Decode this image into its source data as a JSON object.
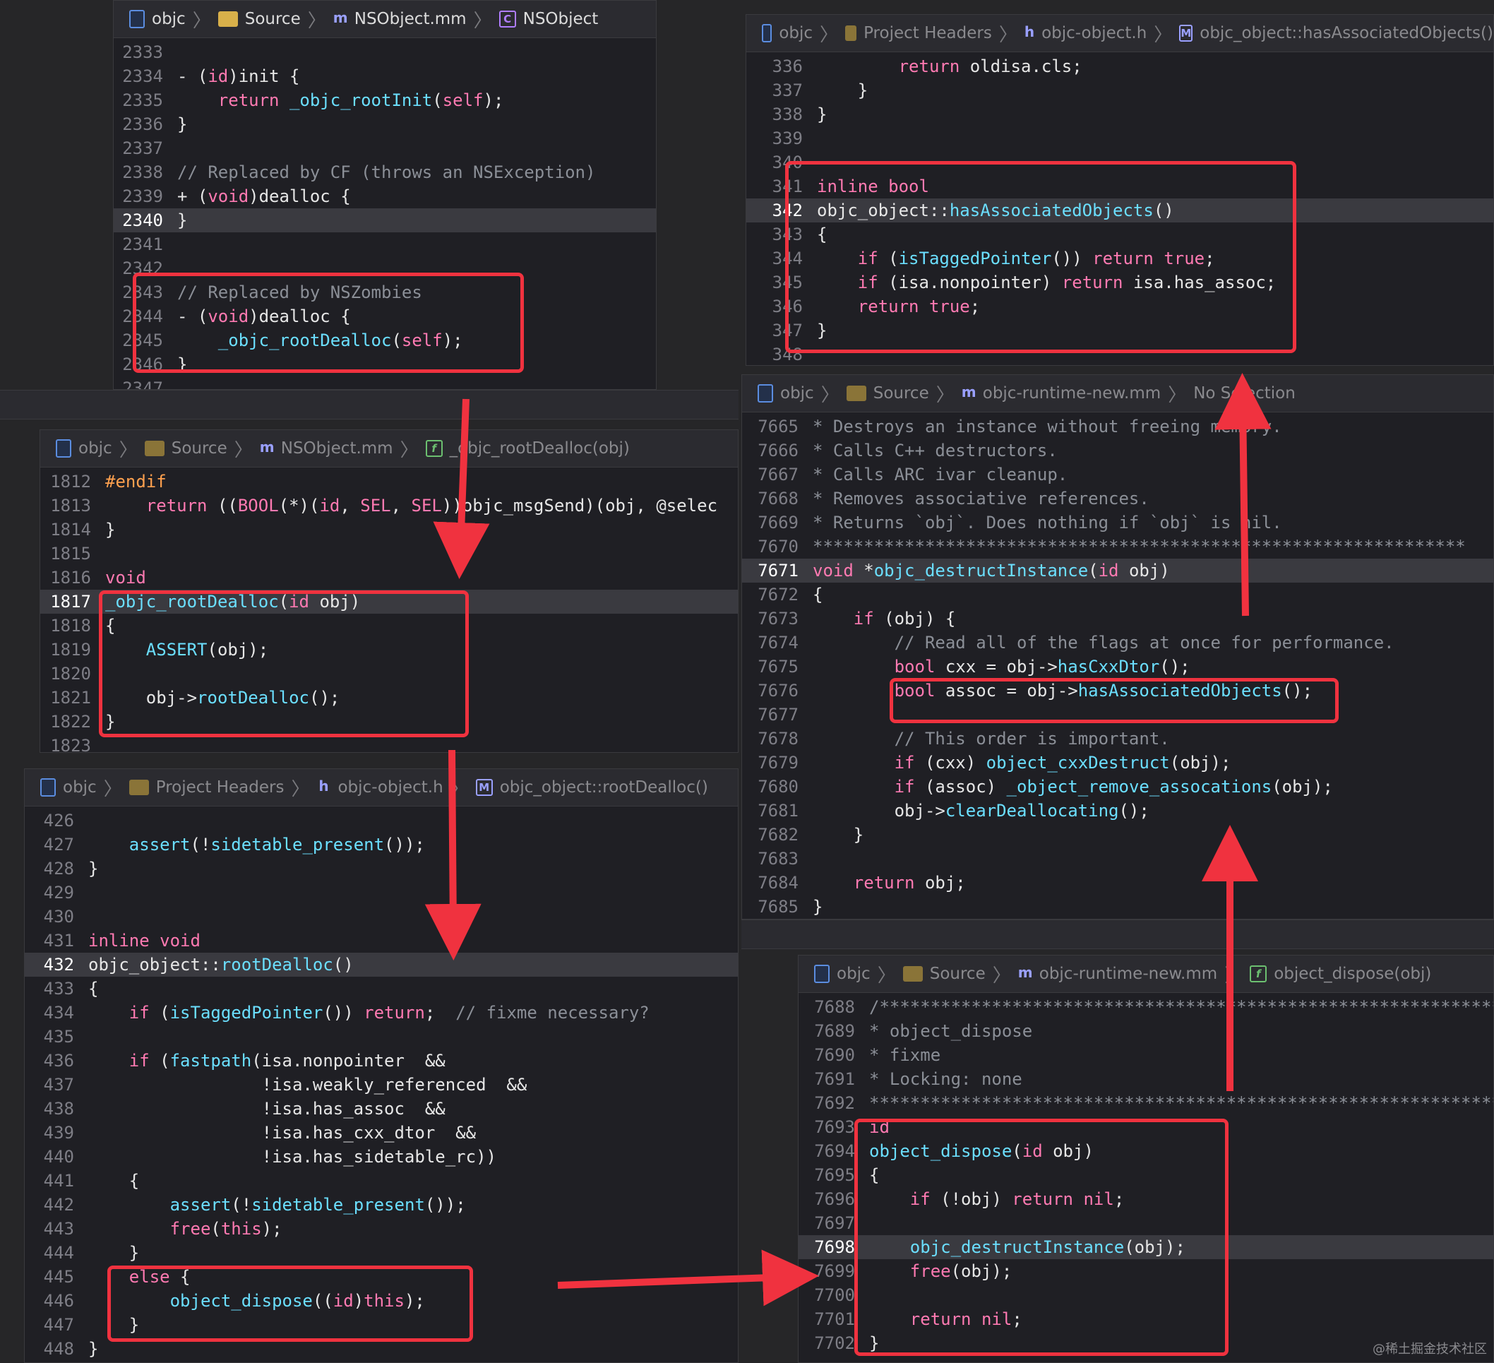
{
  "panes": {
    "nsobject_dealloc": {
      "breadcrumb": [
        "objc",
        "Source",
        "NSObject.mm",
        "NSObject"
      ],
      "lines": [
        {
          "n": "2333",
          "t": ""
        },
        {
          "n": "2334",
          "t": "- (id)init {"
        },
        {
          "n": "2335",
          "t": "    return _objc_rootInit(self);"
        },
        {
          "n": "2336",
          "t": "}"
        },
        {
          "n": "2337",
          "t": ""
        },
        {
          "n": "2338",
          "t": "// Replaced by CF (throws an NSException)"
        },
        {
          "n": "2339",
          "t": "+ (void)dealloc {"
        },
        {
          "n": "2340",
          "t": "}"
        },
        {
          "n": "2341",
          "t": ""
        },
        {
          "n": "2342",
          "t": ""
        },
        {
          "n": "2343",
          "t": "// Replaced by NSZombies"
        },
        {
          "n": "2344",
          "t": "- (void)dealloc {"
        },
        {
          "n": "2345",
          "t": "    _objc_rootDealloc(self);"
        },
        {
          "n": "2346",
          "t": "}"
        },
        {
          "n": "2347",
          "t": ""
        }
      ]
    },
    "root_dealloc_fn": {
      "breadcrumb": [
        "objc",
        "Source",
        "NSObject.mm",
        "_objc_rootDealloc(obj)"
      ],
      "lines": [
        {
          "n": "1812",
          "t": "#endif"
        },
        {
          "n": "1813",
          "t": "    return ((BOOL(*)(id, SEL, SEL))objc_msgSend)(obj, @selec"
        },
        {
          "n": "1814",
          "t": "}"
        },
        {
          "n": "1815",
          "t": ""
        },
        {
          "n": "1816",
          "t": "void"
        },
        {
          "n": "1817",
          "t": "_objc_rootDealloc(id obj)"
        },
        {
          "n": "1818",
          "t": "{"
        },
        {
          "n": "1819",
          "t": "    ASSERT(obj);"
        },
        {
          "n": "1820",
          "t": ""
        },
        {
          "n": "1821",
          "t": "    obj->rootDealloc();"
        },
        {
          "n": "1822",
          "t": "}"
        },
        {
          "n": "1823",
          "t": ""
        }
      ]
    },
    "object_root_dealloc": {
      "breadcrumb": [
        "objc",
        "Project Headers",
        "objc-object.h",
        "objc_object::rootDealloc()"
      ],
      "lines": [
        {
          "n": "426",
          "t": ""
        },
        {
          "n": "427",
          "t": "    assert(!sidetable_present());"
        },
        {
          "n": "428",
          "t": "}"
        },
        {
          "n": "429",
          "t": ""
        },
        {
          "n": "430",
          "t": ""
        },
        {
          "n": "431",
          "t": "inline void"
        },
        {
          "n": "432",
          "t": "objc_object::rootDealloc()"
        },
        {
          "n": "433",
          "t": "{"
        },
        {
          "n": "434",
          "t": "    if (isTaggedPointer()) return;  // fixme necessary?"
        },
        {
          "n": "435",
          "t": ""
        },
        {
          "n": "436",
          "t": "    if (fastpath(isa.nonpointer  &&"
        },
        {
          "n": "437",
          "t": "                 !isa.weakly_referenced  &&"
        },
        {
          "n": "438",
          "t": "                 !isa.has_assoc  &&"
        },
        {
          "n": "439",
          "t": "                 !isa.has_cxx_dtor  &&"
        },
        {
          "n": "440",
          "t": "                 !isa.has_sidetable_rc))"
        },
        {
          "n": "441",
          "t": "    {"
        },
        {
          "n": "442",
          "t": "        assert(!sidetable_present());"
        },
        {
          "n": "443",
          "t": "        free(this);"
        },
        {
          "n": "444",
          "t": "    }"
        },
        {
          "n": "445",
          "t": "    else {"
        },
        {
          "n": "446",
          "t": "        object_dispose((id)this);"
        },
        {
          "n": "447",
          "t": "    }"
        },
        {
          "n": "448",
          "t": "}"
        }
      ]
    },
    "has_associated": {
      "breadcrumb": [
        "objc",
        "Project Headers",
        "objc-object.h",
        "objc_object::hasAssociatedObjects()"
      ],
      "lines": [
        {
          "n": "336",
          "t": "        return oldisa.cls;"
        },
        {
          "n": "337",
          "t": "    }"
        },
        {
          "n": "338",
          "t": "}"
        },
        {
          "n": "339",
          "t": ""
        },
        {
          "n": "340",
          "t": ""
        },
        {
          "n": "341",
          "t": "inline bool"
        },
        {
          "n": "342",
          "t": "objc_object::hasAssociatedObjects()"
        },
        {
          "n": "343",
          "t": "{"
        },
        {
          "n": "344",
          "t": "    if (isTaggedPointer()) return true;"
        },
        {
          "n": "345",
          "t": "    if (isa.nonpointer) return isa.has_assoc;"
        },
        {
          "n": "346",
          "t": "    return true;"
        },
        {
          "n": "347",
          "t": "}"
        },
        {
          "n": "348",
          "t": ""
        }
      ]
    },
    "destruct_instance": {
      "breadcrumb": [
        "objc",
        "Source",
        "objc-runtime-new.mm",
        "No Selection"
      ],
      "lines": [
        {
          "n": "7665",
          "t": "* Destroys an instance without freeing memory."
        },
        {
          "n": "7666",
          "t": "* Calls C++ destructors."
        },
        {
          "n": "7667",
          "t": "* Calls ARC ivar cleanup."
        },
        {
          "n": "7668",
          "t": "* Removes associative references."
        },
        {
          "n": "7669",
          "t": "* Returns `obj`. Does nothing if `obj` is nil."
        },
        {
          "n": "7670",
          "t": "****************************************************************"
        },
        {
          "n": "7671",
          "t": "void *objc_destructInstance(id obj)"
        },
        {
          "n": "7672",
          "t": "{"
        },
        {
          "n": "7673",
          "t": "    if (obj) {"
        },
        {
          "n": "7674",
          "t": "        // Read all of the flags at once for performance."
        },
        {
          "n": "7675",
          "t": "        bool cxx = obj->hasCxxDtor();"
        },
        {
          "n": "7676",
          "t": "        bool assoc = obj->hasAssociatedObjects();"
        },
        {
          "n": "7677",
          "t": ""
        },
        {
          "n": "7678",
          "t": "        // This order is important."
        },
        {
          "n": "7679",
          "t": "        if (cxx) object_cxxDestruct(obj);"
        },
        {
          "n": "7680",
          "t": "        if (assoc) _object_remove_assocations(obj);"
        },
        {
          "n": "7681",
          "t": "        obj->clearDeallocating();"
        },
        {
          "n": "7682",
          "t": "    }"
        },
        {
          "n": "7683",
          "t": ""
        },
        {
          "n": "7684",
          "t": "    return obj;"
        },
        {
          "n": "7685",
          "t": "}"
        }
      ]
    },
    "object_dispose": {
      "breadcrumb": [
        "objc",
        "Source",
        "objc-runtime-new.mm",
        "object_dispose(obj)"
      ],
      "lines": [
        {
          "n": "7688",
          "t": "/***************************************************************"
        },
        {
          "n": "7689",
          "t": "* object_dispose"
        },
        {
          "n": "7690",
          "t": "* fixme"
        },
        {
          "n": "7691",
          "t": "* Locking: none"
        },
        {
          "n": "7692",
          "t": "****************************************************************"
        },
        {
          "n": "7693",
          "t": "id"
        },
        {
          "n": "7694",
          "t": "object_dispose(id obj)"
        },
        {
          "n": "7695",
          "t": "{"
        },
        {
          "n": "7696",
          "t": "    if (!obj) return nil;"
        },
        {
          "n": "7697",
          "t": ""
        },
        {
          "n": "7698",
          "t": "    objc_destructInstance(obj);"
        },
        {
          "n": "7699",
          "t": "    free(obj);"
        },
        {
          "n": "7700",
          "t": ""
        },
        {
          "n": "7701",
          "t": "    return nil;"
        },
        {
          "n": "7702",
          "t": "}"
        }
      ]
    }
  },
  "watermark": "@稀土掘金技术社区",
  "colors": {
    "keyword": "#ff7ab2",
    "function": "#6bdfff",
    "comment": "#8b8f97",
    "highlight_box": "#f0323f"
  }
}
